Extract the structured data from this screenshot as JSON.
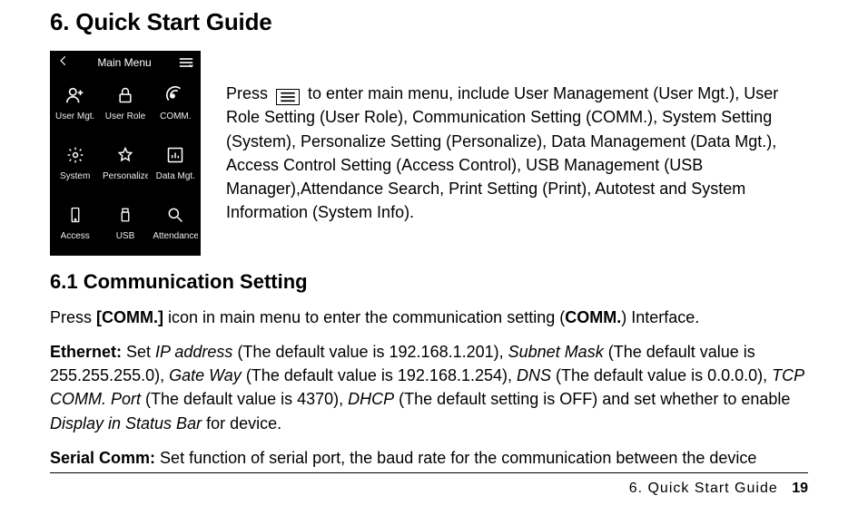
{
  "heading": "6. Quick Start Guide",
  "phone": {
    "topbar_title": "Main Menu",
    "cells": [
      {
        "label": "User Mgt."
      },
      {
        "label": "User Role"
      },
      {
        "label": "COMM."
      },
      {
        "label": "System"
      },
      {
        "label": "Personalize"
      },
      {
        "label": "Data Mgt."
      },
      {
        "label": "Access"
      },
      {
        "label": "USB"
      },
      {
        "label": "Attendance"
      }
    ]
  },
  "intro": {
    "before_icon": "Press",
    "after_icon": "to enter main menu, include User Management (User Mgt.), User Role Setting (User Role), Communication Setting (COMM.), System Setting (System), Personalize Setting (Personalize), Data Management (Data Mgt.), Access Control Setting (Access Control), USB Management (USB Manager),Attendance Search, Print Setting (Print), Autotest and System Information (System Info)."
  },
  "subheading": "6.1 Communication Setting",
  "para1": {
    "a": "Press ",
    "b": "[COMM.]",
    "c": " icon in  main menu  to enter the communication setting (",
    "d": "COMM.",
    "e": ") Interface."
  },
  "para2": {
    "lead": "Ethernet: ",
    "t1": "Set ",
    "i1": "IP address",
    "t2": " (The default value is 192.168.1.201), ",
    "i2": "Subnet Mask",
    "t3": " (The default value is 255.255.255.0), ",
    "i3": "Gate Way",
    "t4": " (The default value is 192.168.1.254), ",
    "i4": "DNS",
    "t5": " (The default value is 0.0.0.0), ",
    "i5": "TCP COMM. Port",
    "t6": " (The default value is 4370), ",
    "i6": "DHCP",
    "t7": " (The default setting is OFF) and set whether to enable ",
    "i7": "Display in Status Bar",
    "t8": " for device."
  },
  "para3": {
    "lead": "Serial Comm: ",
    "rest": "Set function of serial port, the baud rate for the communication between the device"
  },
  "footer": {
    "label": "6.  Quick  Start  Guide",
    "page": "19"
  }
}
